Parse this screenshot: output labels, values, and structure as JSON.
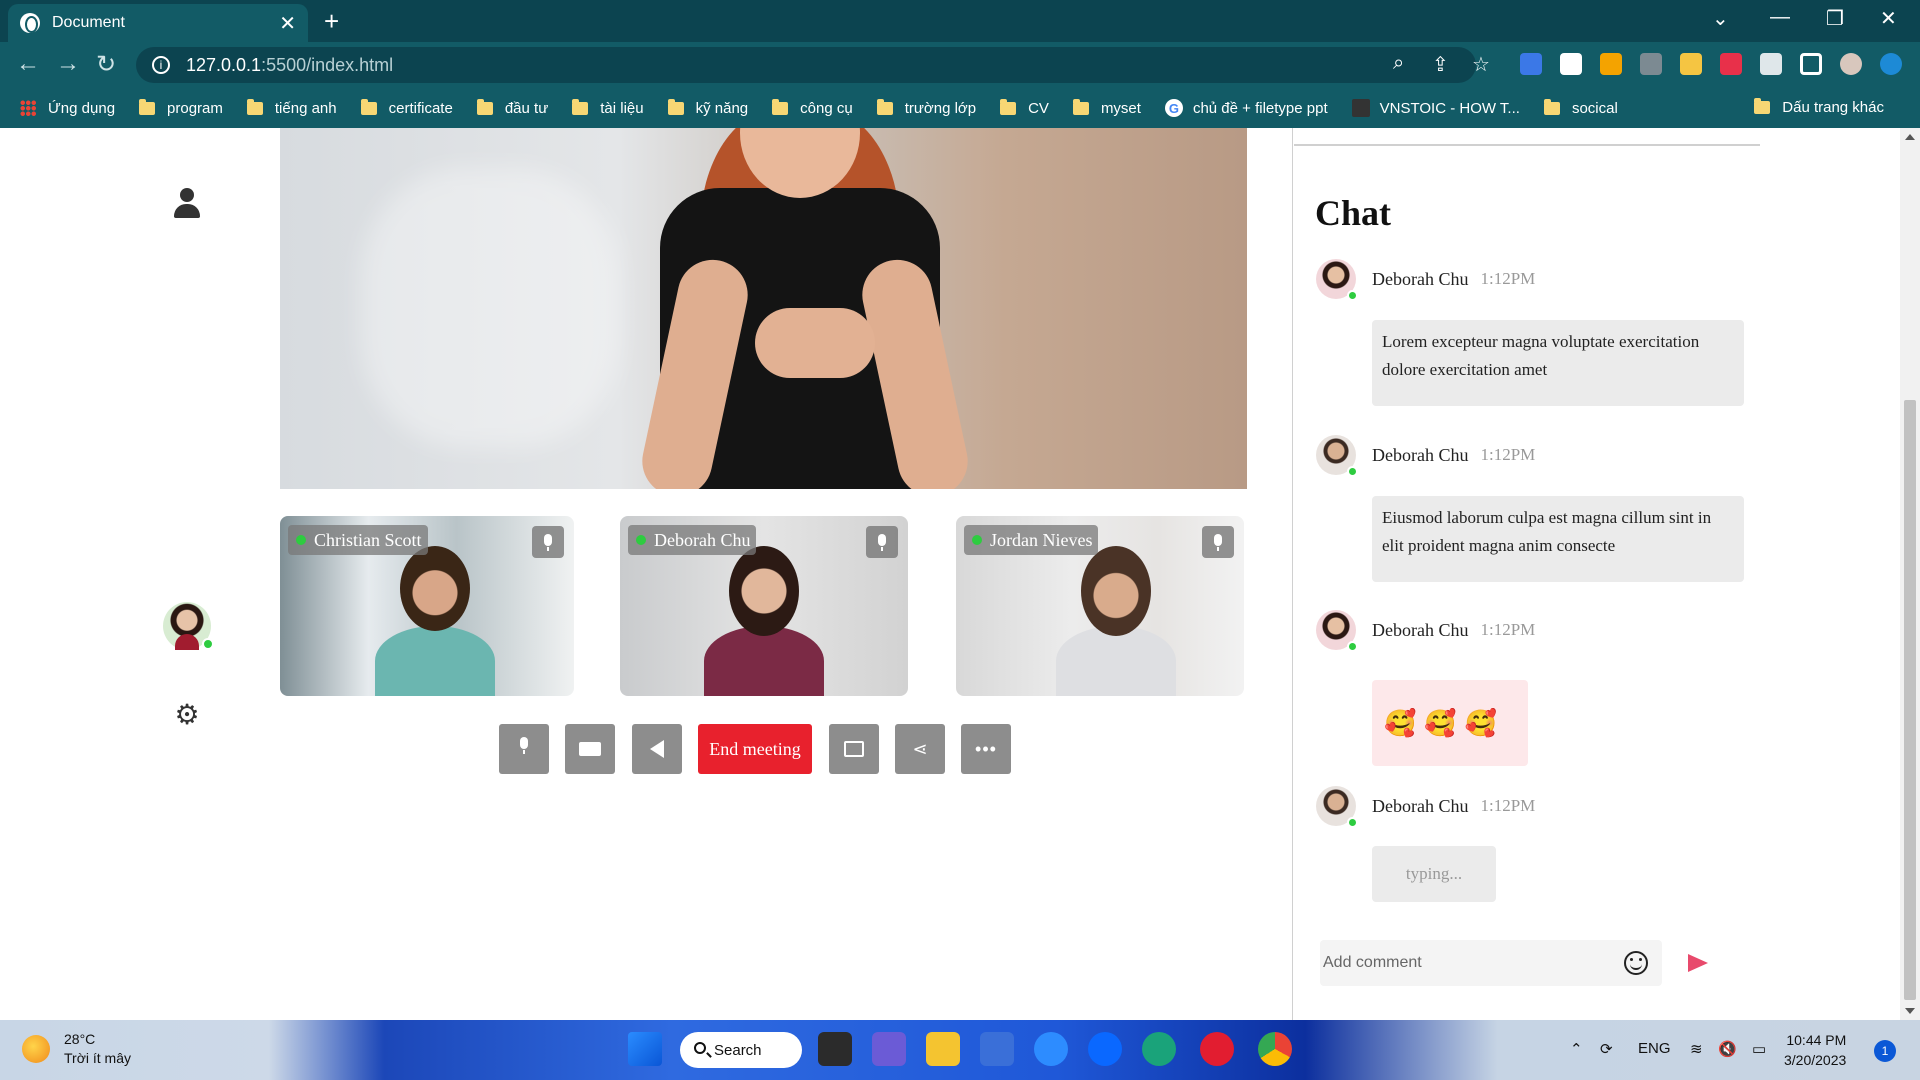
{
  "browser": {
    "tab_title": "Document",
    "tab_close": "✕",
    "new_tab": "+",
    "window_controls": {
      "tab_search": "⌄",
      "minimize": "—",
      "restore": "❐",
      "close": "✕"
    },
    "nav": {
      "back": "←",
      "forward": "→",
      "reload": "↻"
    },
    "url_host": "127.0.0.1",
    "url_path": ":5500/index.html",
    "bookmarks": [
      "Ứng dụng",
      "program",
      "tiếng anh",
      "certificate",
      "đầu tư",
      "tài liệu",
      "kỹ năng",
      "công cụ",
      "trường lớp",
      "CV",
      "myset",
      "chủ đề + filetype ppt",
      "VNSTOIC - HOW T...",
      "socical"
    ],
    "bookmarks_other": "Dấu trang khác"
  },
  "meeting": {
    "participants": [
      {
        "name": "Christian Scott"
      },
      {
        "name": "Deborah Chu"
      },
      {
        "name": "Jordan Nieves"
      }
    ],
    "controls": {
      "end_meeting": "End meeting"
    }
  },
  "chat": {
    "title": "Chat",
    "messages": [
      {
        "name": "Deborah Chu",
        "time": "1:12PM",
        "text": "Lorem excepteur magna voluptate exercitation dolore exercitation amet"
      },
      {
        "name": "Deborah Chu",
        "time": "1:12PM",
        "text": "Eiusmod laborum culpa est magna cillum sint in elit proident magna anim consecte"
      },
      {
        "name": "Deborah Chu",
        "time": "1:12PM",
        "emojis": [
          "🥰",
          "🥰",
          "🥰"
        ]
      },
      {
        "name": "Deborah Chu",
        "time": "1:12PM",
        "typing": "typing..."
      }
    ],
    "comment_placeholder": "Add comment"
  },
  "taskbar": {
    "weather_temp": "28°C",
    "weather_desc": "Trời ít mây",
    "search_label": "Search",
    "language": "ENG",
    "time": "10:44 PM",
    "date": "3/20/2023",
    "notifications": "1"
  },
  "colors": {
    "end_meeting": "#e8212d",
    "online": "#2ecc40",
    "send": "#e84a6c",
    "browser_chrome": "#125b66"
  }
}
